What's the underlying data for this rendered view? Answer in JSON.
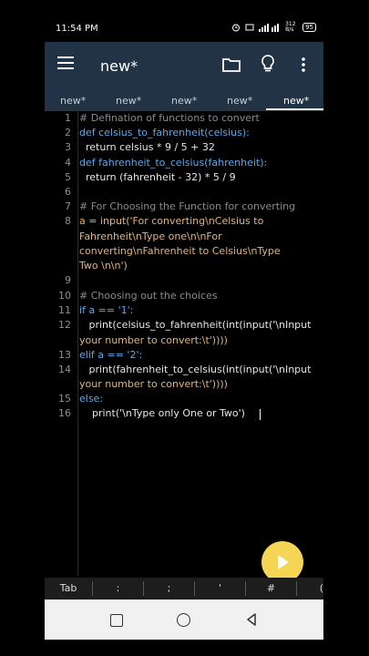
{
  "status_bar": {
    "time": "11:54 PM",
    "network_speed": "312 B/s",
    "battery": "95"
  },
  "app_bar": {
    "title": "new*"
  },
  "tabs": [
    {
      "label": "new*"
    },
    {
      "label": "new*"
    },
    {
      "label": "new*"
    },
    {
      "label": "new*"
    },
    {
      "label": "new*"
    }
  ],
  "editor": {
    "line_numbers": [
      "1",
      "2",
      "3",
      "4",
      "5",
      "6",
      "7",
      "8",
      "9",
      "10",
      "11",
      "12",
      "13",
      "14",
      "15",
      "16"
    ],
    "lines": [
      "# Defination of functions to convert",
      "def celsius_to_fahrenheit(celsius):",
      "  return celsius * 9 / 5 + 32",
      "def fahrenheit_to_celsius(fahrenheit):",
      "  return (fahrenheit - 32) * 5 / 9",
      "",
      "# For Choosing the Function for converting",
      "a = input('For converting\\nCelsius to",
      "Fahrenheit\\nType one\\n\\nFor",
      "converting\\nFahrenheit to Celsius\\nType",
      "Two \\n\\n')",
      "",
      "# Choosing out the choices",
      "if a == '1':",
      "   print(celsius_to_fahrenheit(int(input('\\nInput",
      "your number to convert:\\t'))))",
      "elif a == '2':",
      "   print(fahrenheit_to_celsius(int(input('\\nInput",
      "your number to convert:\\t'))))",
      "else:",
      "    print('\\nType only One or Two')"
    ]
  },
  "keyboard_bar": {
    "keys": [
      "Tab",
      ":",
      ";",
      "'",
      "#",
      "("
    ]
  },
  "colors": {
    "app_bar": "#233346",
    "keyword": "#5fa8e8",
    "comment": "#8a8a8a",
    "string": "#e0b47a",
    "fab": "#f4d554"
  }
}
